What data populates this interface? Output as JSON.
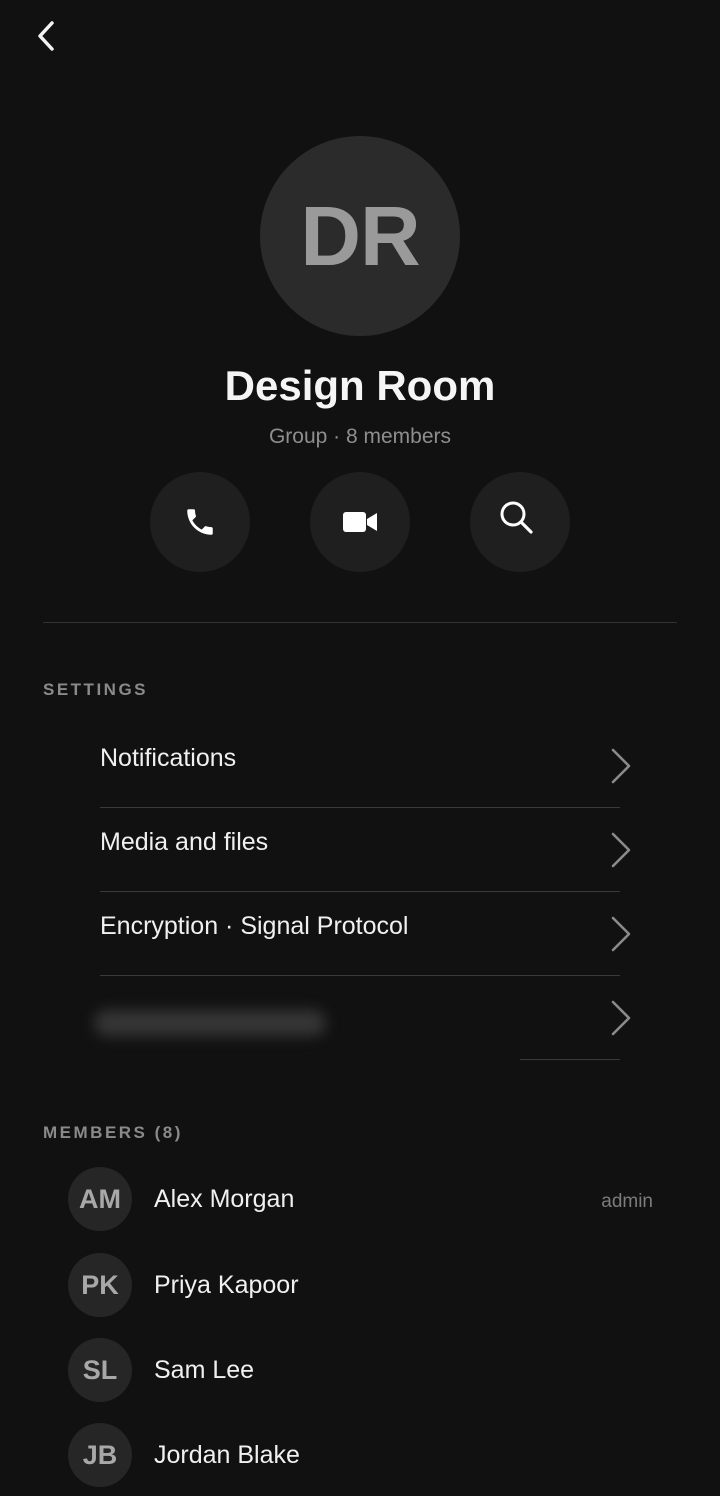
{
  "header": {
    "back_icon": "chevron-left-icon"
  },
  "group": {
    "initials": "DR",
    "name": "Design Room",
    "subtitle": "Group · 8 members"
  },
  "actions": [
    {
      "icon": "phone-icon"
    },
    {
      "icon": "video-icon"
    },
    {
      "icon": "search-icon"
    }
  ],
  "settings": {
    "heading": "SETTINGS",
    "items": [
      {
        "label": "Notifications"
      },
      {
        "label": "Media and files"
      },
      {
        "label": "Encryption · Signal Protocol"
      }
    ]
  },
  "members": {
    "heading": "MEMBERS (8)",
    "list": [
      {
        "initials": "AM",
        "name": "Alex Morgan",
        "role": "admin"
      },
      {
        "initials": "PK",
        "name": "Priya Kapoor",
        "role": ""
      },
      {
        "initials": "SL",
        "name": "Sam Lee",
        "role": ""
      },
      {
        "initials": "JB",
        "name": "Jordan Blake",
        "role": ""
      }
    ]
  },
  "colors": {
    "background": "#111111",
    "avatar_bg": "#2b2b2b",
    "action_bg": "#1f1f1f",
    "muted_text": "#8e8e8e"
  }
}
